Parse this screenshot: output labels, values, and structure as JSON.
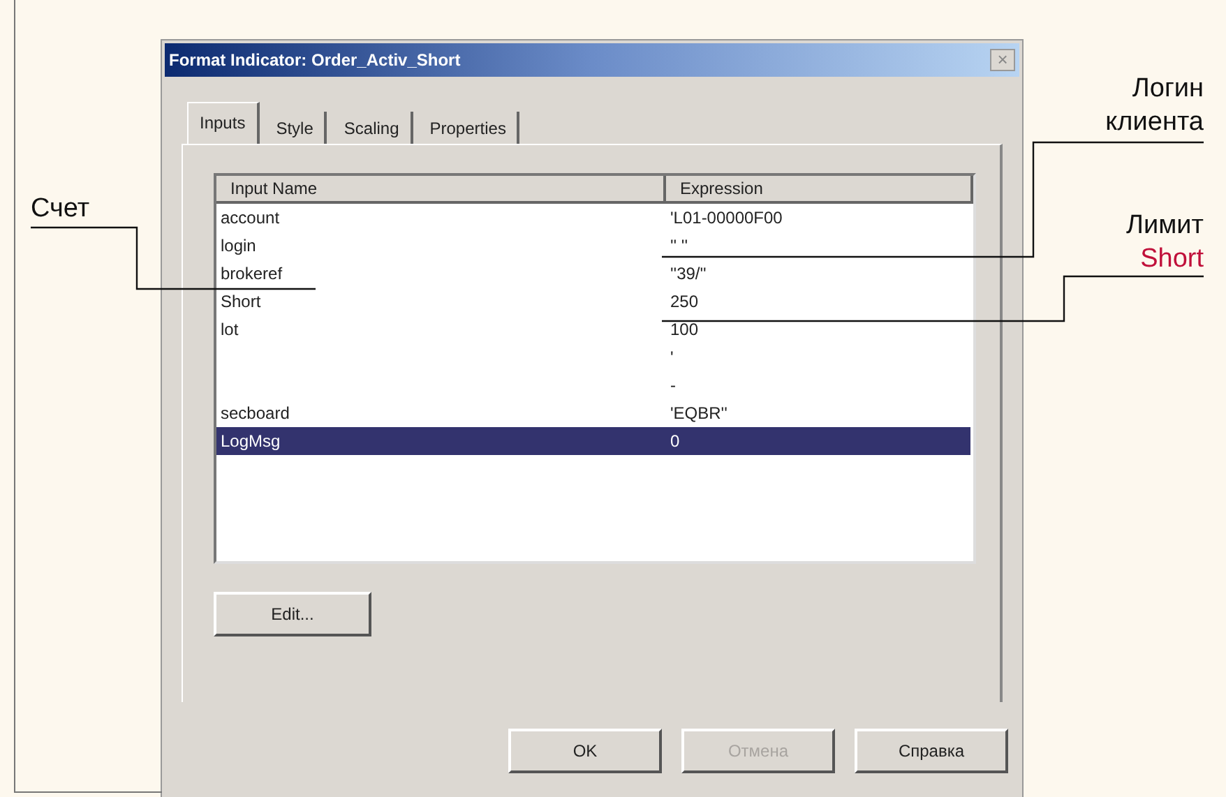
{
  "window": {
    "title": "Format Indicator: Order_Activ_Short",
    "close": "×"
  },
  "tabs": [
    {
      "label": "Inputs",
      "selected": true
    },
    {
      "label": "Style",
      "selected": false
    },
    {
      "label": "Scaling",
      "selected": false
    },
    {
      "label": "Properties",
      "selected": false
    }
  ],
  "table": {
    "columns": [
      "Input Name",
      "Expression"
    ],
    "rows": [
      {
        "name": "account",
        "expression": "'L01-00000F00",
        "selected": false
      },
      {
        "name": "login",
        "expression": "'' ''",
        "selected": false
      },
      {
        "name": "brokeref",
        "expression": "''39/''",
        "selected": false
      },
      {
        "name": "Short",
        "expression": "250",
        "selected": false
      },
      {
        "name": "lot",
        "expression": "100",
        "selected": false
      },
      {
        "expression": "'",
        "selected": false
      },
      {
        "expression": "-",
        "selected": false
      },
      {
        "name": "secboard",
        "expression": "'EQBR''",
        "selected": false
      },
      {
        "name": "LogMsg",
        "expression": "0",
        "selected": true
      }
    ]
  },
  "edit_button": {
    "label": "Edit...",
    "disabled": false
  },
  "buttons": [
    {
      "label": "OK",
      "disabled": false
    },
    {
      "label": "Отмена",
      "disabled": true
    },
    {
      "label": "Справка",
      "disabled": false
    }
  ],
  "callouts": [
    {
      "lines": [
        {
          "text": "Счет",
          "color": "#111111"
        }
      ]
    },
    {
      "lines": [
        {
          "text": "Логин",
          "color": "#111111"
        },
        {
          "text": "клиента",
          "color": "#111111"
        }
      ]
    },
    {
      "lines": [
        {
          "text": "Лимит",
          "color": "#111111"
        },
        {
          "text": "Short",
          "color": "#c0103a"
        }
      ]
    }
  ]
}
